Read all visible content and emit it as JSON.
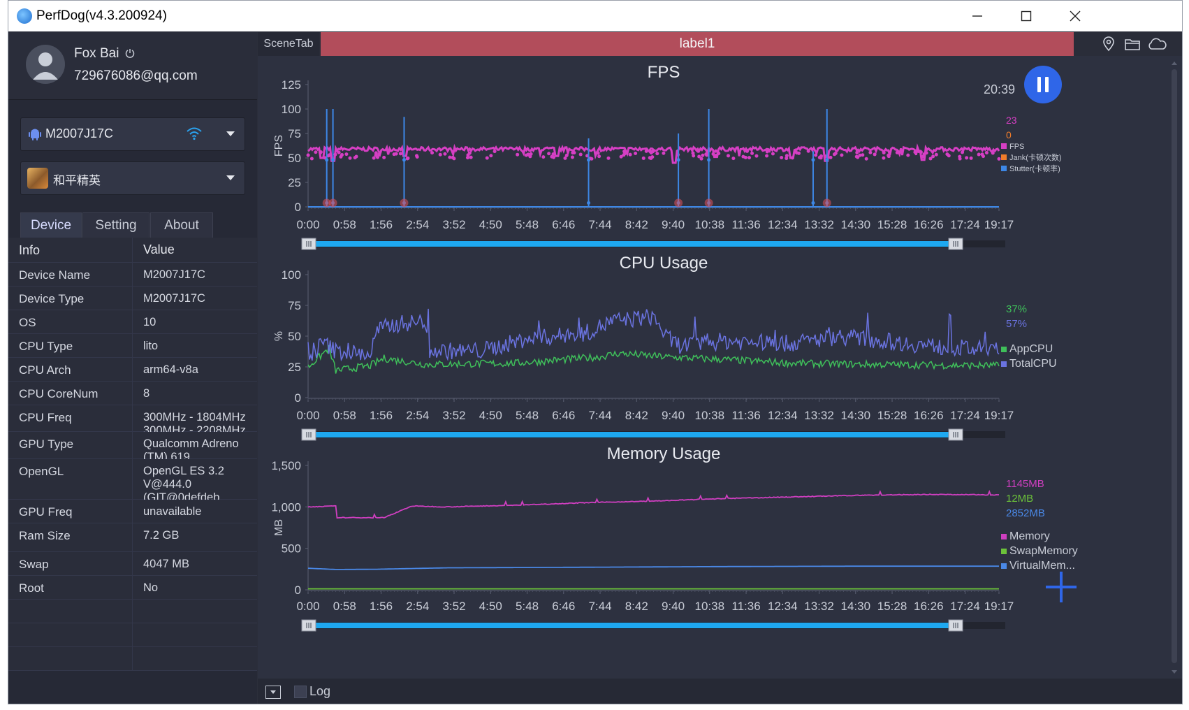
{
  "window": {
    "title": "PerfDog(v4.3.200924)"
  },
  "user": {
    "name": "Fox Bai",
    "email": "729676086@qq.com"
  },
  "device_select": {
    "value": "M2007J17C"
  },
  "app_select": {
    "value": "和平精英"
  },
  "tabs": [
    {
      "label": "Device",
      "active": true
    },
    {
      "label": "Setting",
      "active": false
    },
    {
      "label": "About",
      "active": false
    }
  ],
  "info_table": {
    "headers": [
      "Info",
      "Value"
    ],
    "rows": [
      {
        "key": "Device Name",
        "value": "M2007J17C"
      },
      {
        "key": "Device Type",
        "value": "M2007J17C"
      },
      {
        "key": "OS",
        "value": "10"
      },
      {
        "key": "CPU Type",
        "value": "lito"
      },
      {
        "key": "CPU Arch",
        "value": "arm64-v8a"
      },
      {
        "key": "CPU CoreNum",
        "value": "8"
      },
      {
        "key": "CPU Freq",
        "value": "300MHz - 1804MHz\n300MHz - 2208MHz"
      },
      {
        "key": "GPU Type",
        "value": "Qualcomm Adreno (TM) 619"
      },
      {
        "key": "OpenGL",
        "value": "OpenGL ES 3.2 V@444.0 (GIT@0defdeb"
      },
      {
        "key": "GPU Freq",
        "value": "unavailable"
      },
      {
        "key": "Ram Size",
        "value": "7.2 GB"
      },
      {
        "key": "Swap",
        "value": "4047 MB"
      },
      {
        "key": "Root",
        "value": "No"
      }
    ]
  },
  "header": {
    "scene_tab": "SceneTab",
    "label": "label1"
  },
  "timer": "20:39",
  "bottom": {
    "log_label": "Log"
  },
  "colors": {
    "fps": "#d63fc4",
    "jank": "#f07c2a",
    "stutter": "#3d87e6",
    "app_cpu": "#3fbf5a",
    "total_cpu": "#6a73e0",
    "memory": "#cf3fc0",
    "swap_memory": "#6cc23a",
    "virtual_memory": "#4a88e6",
    "label_bar": "#b24d5b",
    "pause_button": "#2f66e8",
    "range_slider": "#1ea8f0"
  },
  "x_ticks": [
    "0:00",
    "0:58",
    "1:56",
    "2:54",
    "3:52",
    "4:50",
    "5:48",
    "6:46",
    "7:44",
    "8:42",
    "9:40",
    "10:38",
    "11:36",
    "12:34",
    "13:32",
    "14:30",
    "15:28",
    "16:26",
    "17:24",
    "19:17"
  ],
  "chart_data": [
    {
      "type": "line",
      "title": "FPS",
      "ylabel": "FPS",
      "ylim": [
        0,
        125
      ],
      "yticks": [
        "0",
        "25",
        "50",
        "75",
        "100",
        "125"
      ],
      "current_values": [
        {
          "text": "23",
          "color": "#d63fc4"
        },
        {
          "text": "0",
          "color": "#f07c2a"
        }
      ],
      "legend": [
        {
          "name": "FPS",
          "color": "#d63fc4"
        },
        {
          "name": "Jank(卡顿次数)",
          "color": "#f07c2a"
        },
        {
          "name": "Stutter(卡顿率)",
          "color": "#3d87e6"
        }
      ],
      "series": [
        {
          "name": "FPS",
          "baseline": 59,
          "noise": 4,
          "dips": [
            [
              0.02,
              50
            ],
            [
              0.035,
              47
            ],
            [
              0.14,
              52
            ],
            [
              0.36,
              52
            ],
            [
              0.53,
              45
            ],
            [
              0.59,
              51
            ],
            [
              0.7,
              50
            ],
            [
              0.75,
              47
            ],
            [
              0.89,
              48
            ]
          ]
        },
        {
          "name": "Stutter(卡顿率)",
          "baseline": 0,
          "spikes": [
            [
              0.027,
              100
            ],
            [
              0.036,
              100
            ],
            [
              0.139,
              92
            ],
            [
              0.406,
              70
            ],
            [
              0.536,
              75
            ],
            [
              0.58,
              100
            ],
            [
              0.731,
              57
            ],
            [
              0.751,
              100
            ]
          ]
        }
      ],
      "jank_markers": [
        0.027,
        0.036,
        0.139,
        0.536,
        0.58,
        0.751
      ]
    },
    {
      "type": "line",
      "title": "CPU Usage",
      "ylabel": "%",
      "ylim": [
        0,
        100
      ],
      "yticks": [
        "0",
        "25",
        "50",
        "75",
        "100"
      ],
      "current_values": [
        {
          "text": "37%",
          "color": "#3fbf5a"
        },
        {
          "text": "57%",
          "color": "#6a73e0"
        }
      ],
      "legend": [
        {
          "name": "AppCPU",
          "color": "#3fbf5a"
        },
        {
          "name": "TotalCPU",
          "color": "#6a73e0"
        }
      ],
      "series": [
        {
          "name": "AppCPU",
          "profile": [
            [
              0,
              25
            ],
            [
              0.03,
              40
            ],
            [
              0.04,
              22
            ],
            [
              0.09,
              26
            ],
            [
              0.11,
              32
            ],
            [
              0.17,
              27
            ],
            [
              0.3,
              28
            ],
            [
              0.42,
              33
            ],
            [
              0.45,
              36
            ],
            [
              0.52,
              33
            ],
            [
              0.6,
              31
            ],
            [
              0.7,
              28
            ],
            [
              0.8,
              27
            ],
            [
              1,
              26
            ]
          ],
          "noise": 6
        },
        {
          "name": "TotalCPU",
          "profile": [
            [
              0,
              28
            ],
            [
              0.02,
              45
            ],
            [
              0.04,
              38
            ],
            [
              0.09,
              35
            ],
            [
              0.1,
              55
            ],
            [
              0.13,
              60
            ],
            [
              0.17,
              62
            ],
            [
              0.175,
              38
            ],
            [
              0.25,
              38
            ],
            [
              0.32,
              48
            ],
            [
              0.4,
              52
            ],
            [
              0.44,
              62
            ],
            [
              0.5,
              66
            ],
            [
              0.52,
              48
            ],
            [
              0.54,
              42
            ],
            [
              0.6,
              46
            ],
            [
              0.7,
              44
            ],
            [
              0.77,
              50
            ],
            [
              0.9,
              42
            ],
            [
              1,
              38
            ]
          ],
          "noise": 14
        }
      ]
    },
    {
      "type": "line",
      "title": "Memory Usage",
      "ylabel": "MB",
      "ylim": [
        0,
        1500
      ],
      "yticks": [
        "0",
        "500",
        "1,000",
        "1,500"
      ],
      "current_values": [
        {
          "text": "1145MB",
          "color": "#cf3fc0"
        },
        {
          "text": "12MB",
          "color": "#6cc23a"
        },
        {
          "text": "2852MB",
          "color": "#4a88e6"
        }
      ],
      "legend": [
        {
          "name": "Memory",
          "color": "#cf3fc0"
        },
        {
          "name": "SwapMemory",
          "color": "#6cc23a"
        },
        {
          "name": "VirtualMem...",
          "color": "#4a88e6"
        }
      ],
      "series": [
        {
          "name": "Memory",
          "profile": [
            [
              0,
              1000
            ],
            [
              0.04,
              1010
            ],
            [
              0.041,
              870
            ],
            [
              0.11,
              870
            ],
            [
              0.13,
              940
            ],
            [
              0.15,
              1010
            ],
            [
              0.2,
              1000
            ],
            [
              0.3,
              1020
            ],
            [
              0.4,
              1050
            ],
            [
              0.5,
              1070
            ],
            [
              0.6,
              1100
            ],
            [
              0.7,
              1120
            ],
            [
              0.8,
              1140
            ],
            [
              0.9,
              1150
            ],
            [
              1,
              1145
            ]
          ]
        },
        {
          "name": "SwapMemory",
          "profile": [
            [
              0,
              12
            ],
            [
              1,
              12
            ]
          ]
        },
        {
          "name": "VirtualMem...",
          "profile": [
            [
              0,
              260
            ],
            [
              0.04,
              245
            ],
            [
              0.1,
              248
            ],
            [
              0.2,
              265
            ],
            [
              0.4,
              272
            ],
            [
              0.6,
              280
            ],
            [
              0.8,
              285
            ],
            [
              1,
              285
            ]
          ]
        }
      ]
    }
  ]
}
